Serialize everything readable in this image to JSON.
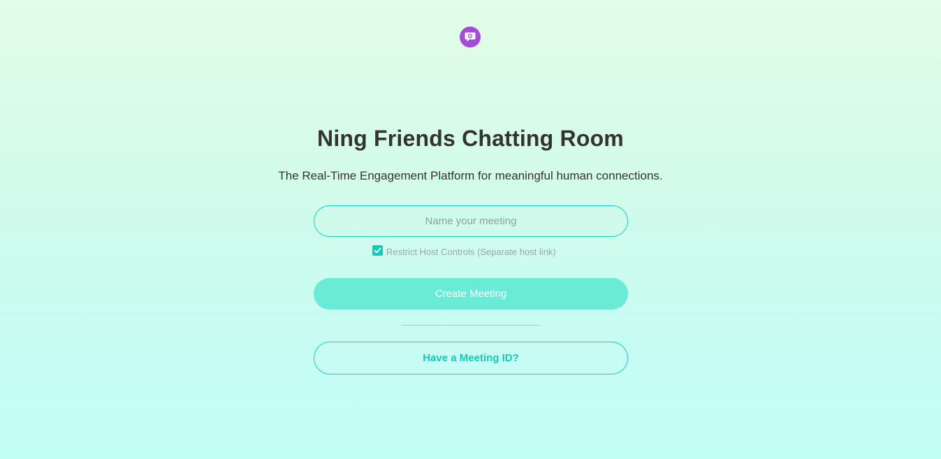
{
  "brand": {
    "logo_icon": "chat-bubble-icon",
    "logo_color": "#a54bd6"
  },
  "hero": {
    "title": "Ning Friends Chatting Room",
    "subtitle": "The Real-Time Engagement Platform for meaningful human connections."
  },
  "form": {
    "meeting_name": {
      "value": "",
      "placeholder": "Name your meeting"
    },
    "restrict_host_controls": {
      "checked": true,
      "label": "Restrict Host Controls (Separate host link)"
    },
    "create_button_label": "Create Meeting",
    "meeting_id_button_label": "Have a Meeting ID?"
  },
  "colors": {
    "accent": "#15c9b9",
    "primary_button_bg": "#69ebd6",
    "text": "#333333",
    "muted_text": "#99a6a5"
  }
}
